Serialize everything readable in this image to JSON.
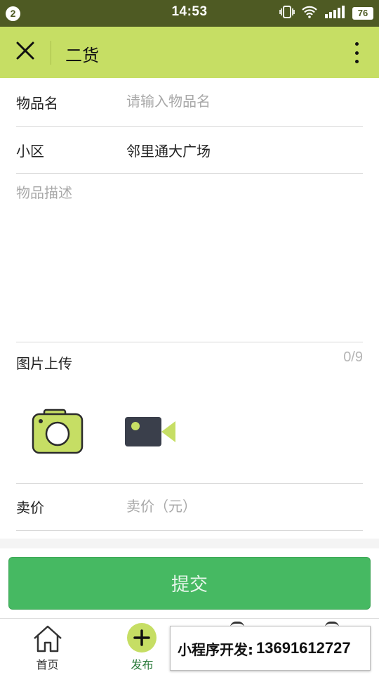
{
  "status_bar": {
    "notification_count": "2",
    "time": "14:53",
    "battery": "76",
    "icons": [
      "vibrate-icon",
      "wifi-icon",
      "signal-icon"
    ]
  },
  "header": {
    "title": "二货",
    "close_icon": "close-icon",
    "more_icon": "more-vertical-icon",
    "background": "#c6de64"
  },
  "form": {
    "item_name": {
      "label": "物品名",
      "placeholder": "请输入物品名",
      "value": ""
    },
    "community": {
      "label": "小区",
      "value": "邻里通大广场"
    },
    "description": {
      "placeholder": "物品描述",
      "value": ""
    },
    "upload": {
      "label": "图片上传",
      "count": "0/9",
      "buttons": [
        "camera-icon",
        "video-camera-icon"
      ]
    },
    "price": {
      "label": "卖价",
      "placeholder": "卖价（元）",
      "value": ""
    }
  },
  "submit": {
    "label": "提交",
    "color": "#46b962"
  },
  "tabbar": {
    "tabs": [
      {
        "label": "首页",
        "icon": "home-icon"
      },
      {
        "label": "发布",
        "icon": "plus-icon",
        "active": true
      }
    ]
  },
  "watermark": {
    "prefix": "小程序开发:",
    "phone": "13691612727"
  }
}
